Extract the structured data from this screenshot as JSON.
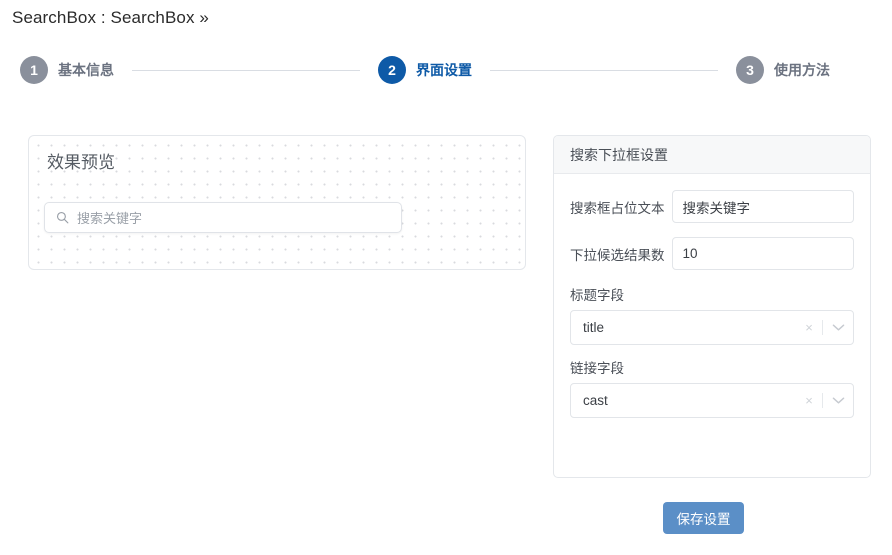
{
  "breadcrumb": {
    "text": "SearchBox : SearchBox »"
  },
  "steps": [
    {
      "number": "1",
      "label": "基本信息",
      "state": "inactive"
    },
    {
      "number": "2",
      "label": "界面设置",
      "state": "active"
    },
    {
      "number": "3",
      "label": "使用方法",
      "state": "inactive"
    }
  ],
  "preview": {
    "title": "效果预览",
    "search_placeholder": "搜索关键字",
    "search_icon": "search-icon"
  },
  "settings": {
    "header_title": "搜索下拉框设置",
    "fields": {
      "placeholder_text": {
        "label": "搜索框占位文本",
        "value": "搜索关键字"
      },
      "result_count": {
        "label": "下拉候选结果数",
        "value": "10"
      },
      "title_field": {
        "label": "标题字段",
        "value": "title",
        "clear_icon": "×",
        "arrow_icon": "chevron-down-icon"
      },
      "link_field": {
        "label": "链接字段",
        "value": "cast",
        "clear_icon": "×",
        "arrow_icon": "chevron-down-icon"
      }
    }
  },
  "actions": {
    "save_label": "保存设置"
  },
  "colors": {
    "active_step": "#0e5aa7",
    "inactive_step": "#8a909c",
    "save_button": "#5b8fc7",
    "panel_header_bg": "#f7f8f9",
    "border": "#e4e7eb"
  }
}
